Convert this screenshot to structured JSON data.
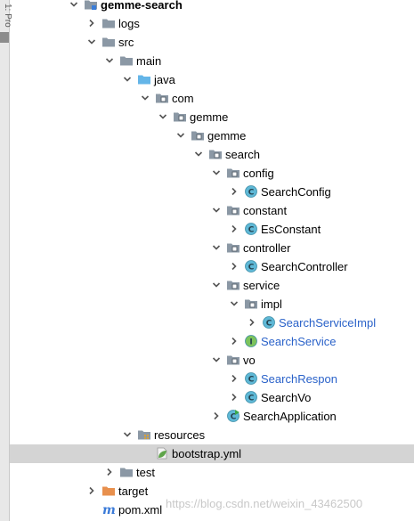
{
  "side_tab": {
    "label": "1: Pro"
  },
  "colors": {
    "folder": "#8b98a5",
    "source_folder": "#64b5e8",
    "resources_folder": "#b8a78a",
    "target_folder": "#e8904e",
    "class_icon": "#5fb8d6",
    "interface_icon": "#7cc35c",
    "link_text": "#2a62c9",
    "selection": "#d4d4d4"
  },
  "tree": {
    "items": [
      {
        "label": "gemme-search",
        "depth": 0,
        "arrow": "down",
        "icon": "module-folder-icon",
        "style": "bold"
      },
      {
        "label": "logs",
        "depth": 1,
        "arrow": "right",
        "icon": "folder-icon"
      },
      {
        "label": "src",
        "depth": 1,
        "arrow": "down",
        "icon": "folder-icon"
      },
      {
        "label": "main",
        "depth": 2,
        "arrow": "down",
        "icon": "folder-icon"
      },
      {
        "label": "java",
        "depth": 3,
        "arrow": "down",
        "icon": "source-folder-icon"
      },
      {
        "label": "com",
        "depth": 4,
        "arrow": "down",
        "icon": "package-icon"
      },
      {
        "label": "gemme",
        "depth": 5,
        "arrow": "down",
        "icon": "package-icon"
      },
      {
        "label": "gemme",
        "depth": 6,
        "arrow": "down",
        "icon": "package-icon"
      },
      {
        "label": "search",
        "depth": 7,
        "arrow": "down",
        "icon": "package-icon"
      },
      {
        "label": "config",
        "depth": 8,
        "arrow": "down",
        "icon": "package-icon"
      },
      {
        "label": "SearchConfig",
        "depth": 9,
        "arrow": "right",
        "icon": "class-icon"
      },
      {
        "label": "constant",
        "depth": 8,
        "arrow": "down",
        "icon": "package-icon"
      },
      {
        "label": "EsConstant",
        "depth": 9,
        "arrow": "right",
        "icon": "class-icon"
      },
      {
        "label": "controller",
        "depth": 8,
        "arrow": "down",
        "icon": "package-icon"
      },
      {
        "label": "SearchController",
        "depth": 9,
        "arrow": "right",
        "icon": "class-icon"
      },
      {
        "label": "service",
        "depth": 8,
        "arrow": "down",
        "icon": "package-icon"
      },
      {
        "label": "impl",
        "depth": 9,
        "arrow": "down",
        "icon": "package-icon"
      },
      {
        "label": "SearchServiceImpl",
        "depth": 10,
        "arrow": "right",
        "icon": "class-icon",
        "style": "blue"
      },
      {
        "label": "SearchService",
        "depth": 9,
        "arrow": "right",
        "icon": "interface-icon",
        "style": "blue"
      },
      {
        "label": "vo",
        "depth": 8,
        "arrow": "down",
        "icon": "package-icon"
      },
      {
        "label": "SearchRespon",
        "depth": 9,
        "arrow": "right",
        "icon": "class-icon",
        "style": "blue"
      },
      {
        "label": "SearchVo",
        "depth": 9,
        "arrow": "right",
        "icon": "class-icon"
      },
      {
        "label": "SearchApplication",
        "depth": 8,
        "arrow": "right",
        "icon": "spring-boot-class-icon"
      },
      {
        "label": "resources",
        "depth": 3,
        "arrow": "down",
        "icon": "resources-folder-icon"
      },
      {
        "label": "bootstrap.yml",
        "depth": 4,
        "arrow": "none",
        "icon": "spring-yml-icon",
        "selected": true
      },
      {
        "label": "test",
        "depth": 2,
        "arrow": "right",
        "icon": "folder-icon"
      },
      {
        "label": "target",
        "depth": 1,
        "arrow": "right",
        "icon": "target-folder-icon"
      },
      {
        "label": "pom.xml",
        "depth": 1,
        "arrow": "none",
        "icon": "maven-icon"
      }
    ]
  },
  "watermark": {
    "text": "https://blog.csdn.net/weixin_43462500"
  }
}
